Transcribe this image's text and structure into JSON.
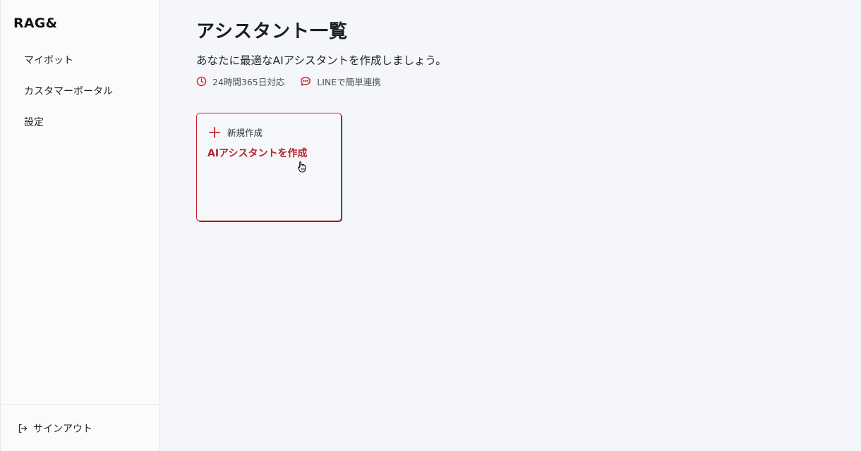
{
  "sidebar": {
    "brand": "RAG&",
    "items": [
      {
        "label": "マイボット"
      },
      {
        "label": "カスタマーポータル"
      },
      {
        "label": "設定"
      }
    ],
    "signout_label": "サインアウト"
  },
  "main": {
    "title": "アシスタント一覧",
    "description": "あなたに最適なAIアシスタントを作成しましょう。",
    "features": [
      {
        "icon": "clock-icon",
        "label": "24時間365日対応"
      },
      {
        "icon": "chat-bubble-icon",
        "label": "LINEで簡単連携"
      }
    ],
    "create_card": {
      "tag": "新規作成",
      "title": "AIアシスタントを作成"
    }
  },
  "colors": {
    "accent": "#c8232e",
    "accent_text": "#b3232d",
    "background": "#f5f6f9",
    "sidebar_background": "#fbfbfc"
  },
  "icons": {
    "signout": "sign-out-icon",
    "create": "plus-icon",
    "cursor": "hand-pointer-icon"
  }
}
